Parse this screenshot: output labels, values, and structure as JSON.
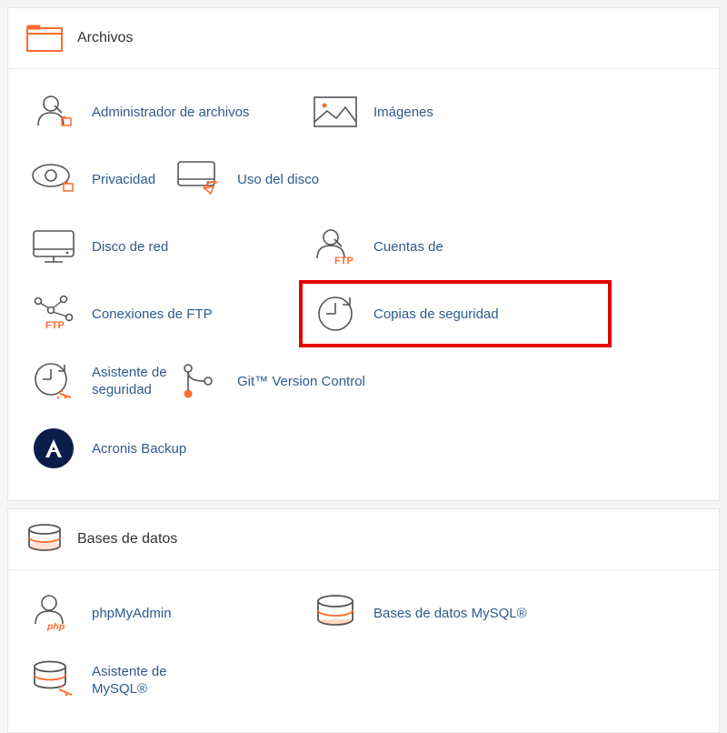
{
  "sections": {
    "archivos": {
      "title": "Archivos",
      "items": [
        {
          "label": "Administrador de archivos"
        },
        {
          "label": "Imágenes"
        },
        {
          "label": "Privacidad"
        },
        {
          "label": "Uso del disco"
        },
        {
          "label": "Disco de red"
        },
        {
          "label": "Cuentas de"
        },
        {
          "label": "Conexiones de FTP"
        },
        {
          "label": "Copias de seguridad"
        },
        {
          "label": "Asistente de seguridad"
        },
        {
          "label": "Git™ Version Control"
        },
        {
          "label": "Acronis Backup"
        }
      ]
    },
    "bases_de_datos": {
      "title": "Bases de datos",
      "items": [
        {
          "label": "phpMyAdmin"
        },
        {
          "label": "Bases de datos MySQL®"
        },
        {
          "label": "Asistente de MySQL®"
        }
      ]
    }
  }
}
